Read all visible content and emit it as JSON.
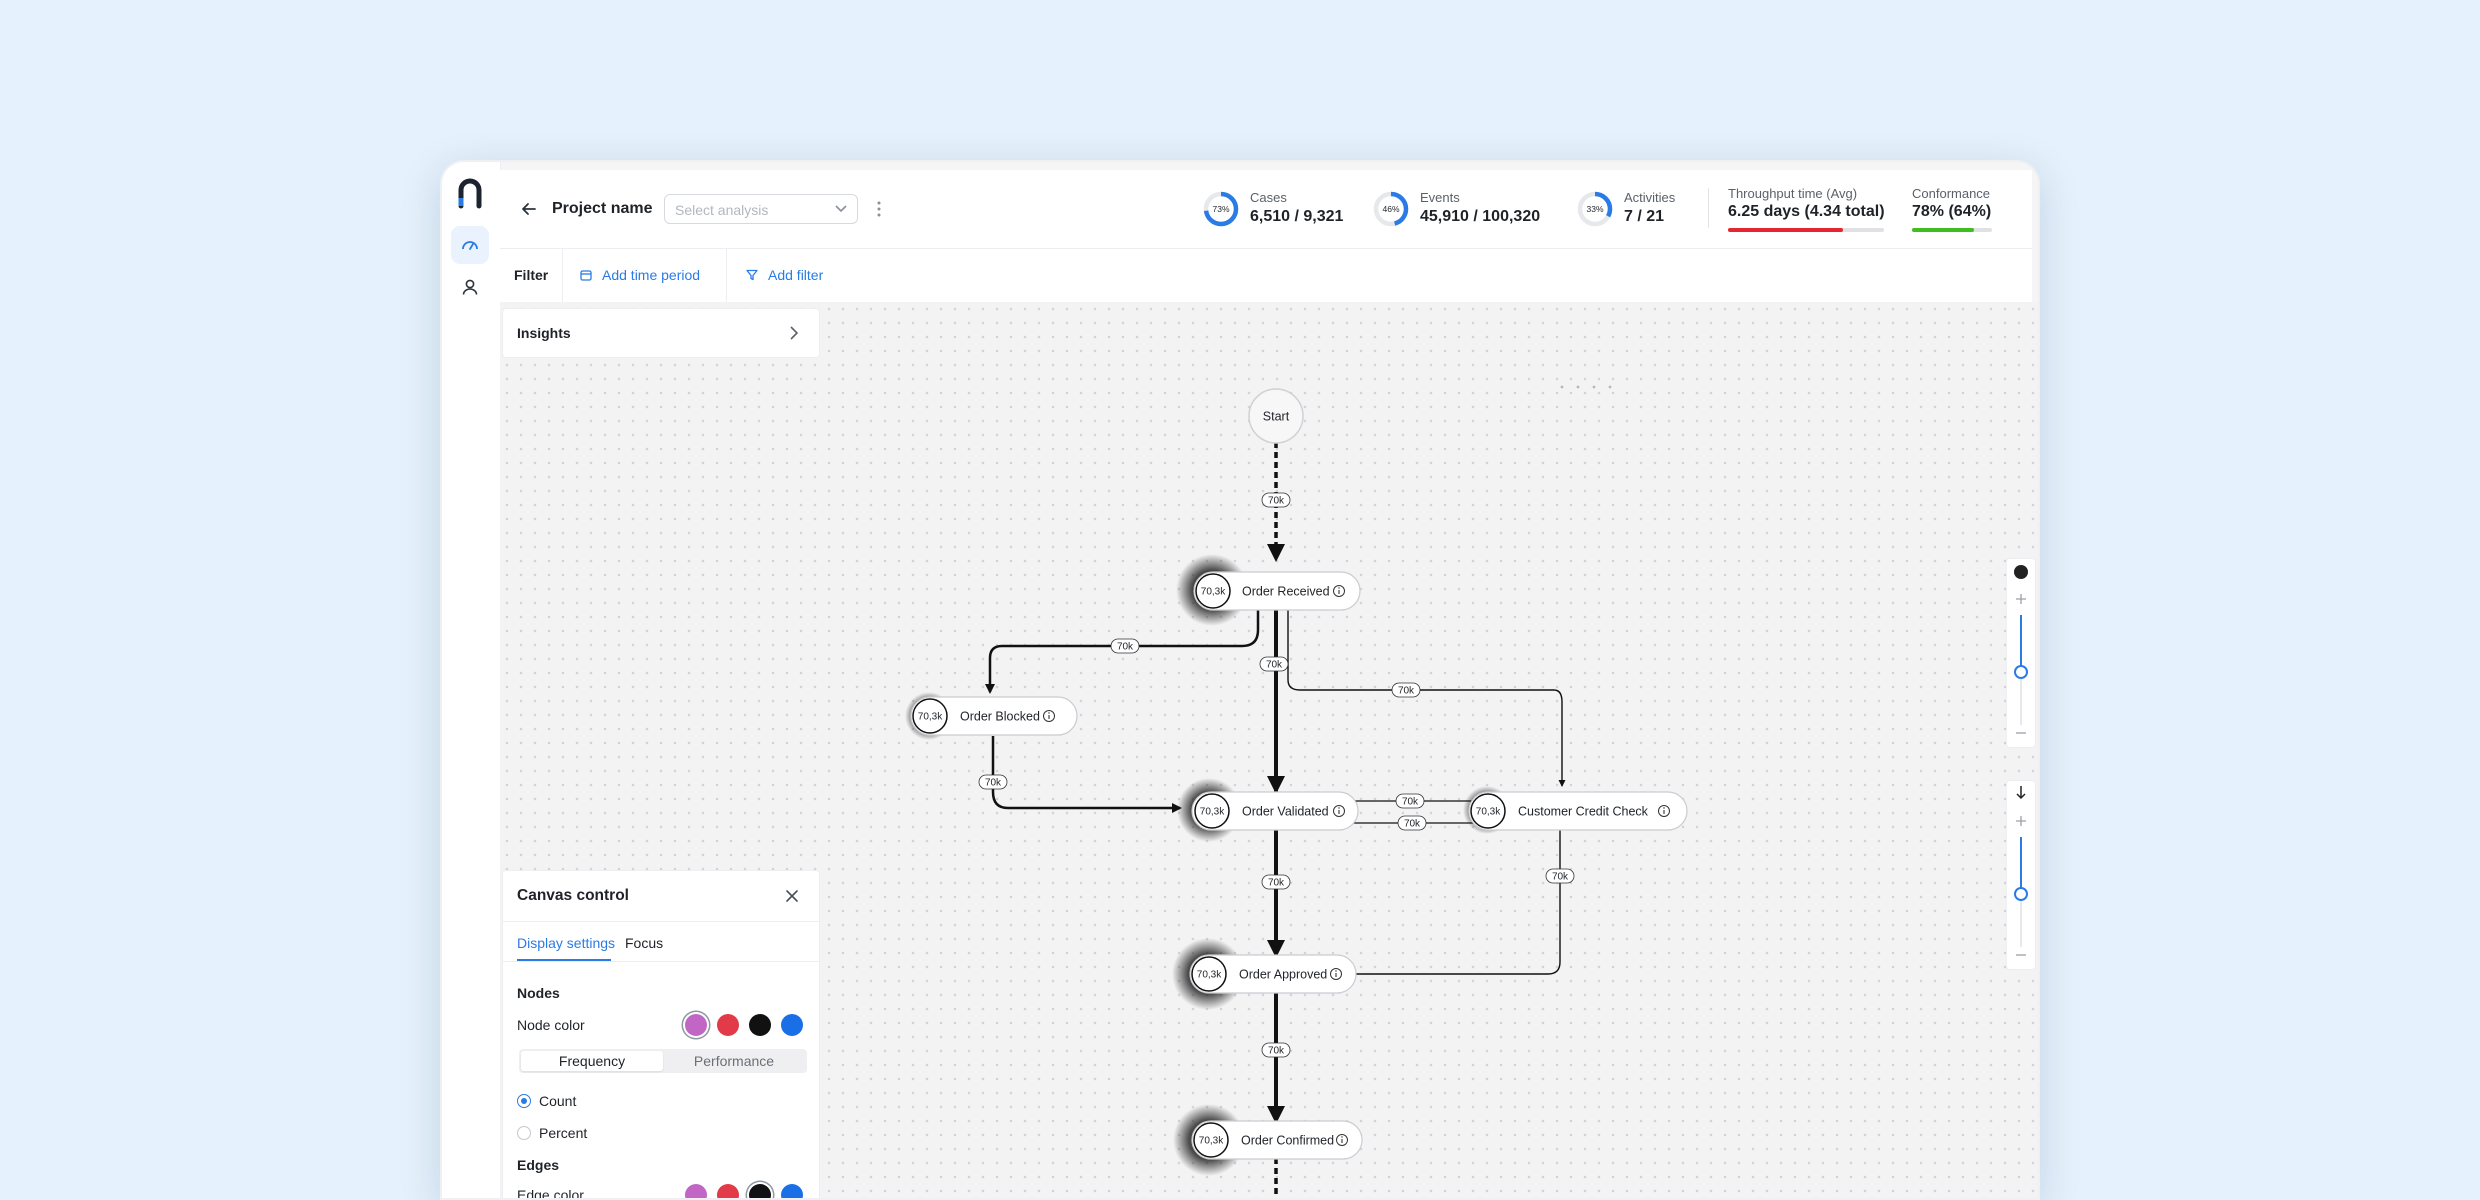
{
  "app": {
    "project_name": "Project name",
    "select_placeholder": "Select analysis"
  },
  "kpis": [
    {
      "label": "Cases",
      "value": "6,510 / 9,321",
      "pct": "73%",
      "fraction": 0.73
    },
    {
      "label": "Events",
      "value": "45,910 / 100,320",
      "pct": "46%",
      "fraction": 0.46
    },
    {
      "label": "Activities",
      "value": "7 / 21",
      "pct": "33%",
      "fraction": 0.33
    }
  ],
  "throughput": {
    "label": "Throughput time (Avg)",
    "value": "6.25 days (4.34 total)",
    "fraction": 0.74,
    "color": "#e5262f"
  },
  "conformance": {
    "label": "Conformance",
    "value": "78% (64%)",
    "fraction": 0.78,
    "color": "#3fbf1f"
  },
  "filter": {
    "label": "Filter",
    "add_time_period": "Add time period",
    "add_filter": "Add filter"
  },
  "insights": {
    "title": "Insights"
  },
  "canvas_control": {
    "title": "Canvas control",
    "tabs": [
      "Display settings",
      "Focus"
    ],
    "nodes_heading": "Nodes",
    "node_color_label": "Node color",
    "segments": [
      "Frequency",
      "Performance"
    ],
    "radios": [
      "Count",
      "Percent"
    ],
    "edges_heading": "Edges",
    "edge_color_label": "Edge color",
    "swatches": [
      "#c266c6",
      "#e23a48",
      "#111111",
      "#1b6fe6"
    ]
  },
  "graph": {
    "start_label": "Start",
    "nodes": [
      {
        "id": "received",
        "label": "Order Received",
        "count": "70,3k"
      },
      {
        "id": "blocked",
        "label": "Order Blocked",
        "count": "70,3k"
      },
      {
        "id": "validated",
        "label": "Order Validated",
        "count": "70,3k"
      },
      {
        "id": "credit",
        "label": "Customer Credit Check",
        "count": "70,3k"
      },
      {
        "id": "approved",
        "label": "Order Approved",
        "count": "70,3k"
      },
      {
        "id": "confirmed",
        "label": "Order Confirmed",
        "count": "70,3k"
      }
    ],
    "edge_label": "70k"
  },
  "colors": {
    "accent": "#2a7be6"
  }
}
